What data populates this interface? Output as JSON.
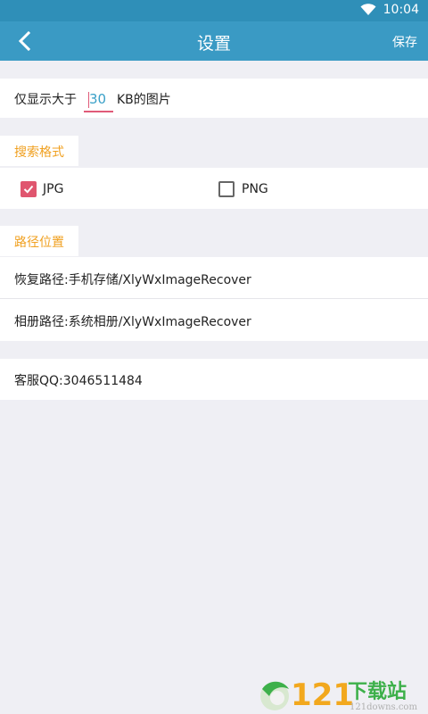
{
  "status_bar": {
    "time": "10:04"
  },
  "app_bar": {
    "title": "设置",
    "save_label": "保存"
  },
  "size_filter": {
    "prefix": "仅显示大于",
    "value": "30",
    "suffix": "KB的图片"
  },
  "format_section": {
    "label": "搜索格式",
    "options": [
      {
        "label": "JPG",
        "checked": true
      },
      {
        "label": "PNG",
        "checked": false
      }
    ]
  },
  "path_section": {
    "label": "路径位置",
    "recover_path": "恢复路径:手机存储/XlyWxImageRecover",
    "album_path": "相册路径:系统相册/XlyWxImageRecover"
  },
  "support": {
    "qq": "客服QQ:3046511484"
  },
  "watermark": {
    "brand": "121下载站",
    "domain": "121downs.com"
  },
  "colors": {
    "appbar": "#3a9ac4",
    "accent_orange": "#f0a020",
    "checkbox_red": "#e0566f",
    "input_blue": "#3aa0c8"
  }
}
